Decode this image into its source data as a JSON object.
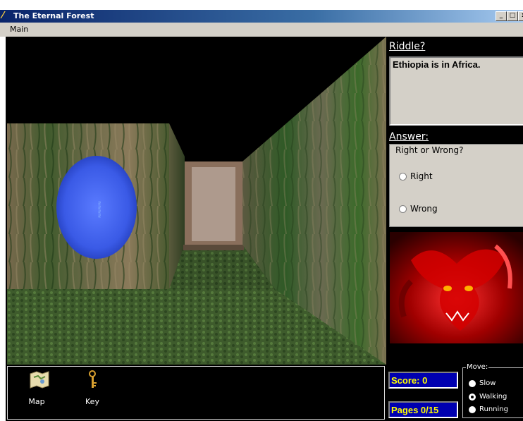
{
  "window": {
    "title": "The Eternal Forest",
    "minimize": "_",
    "maximize": "□",
    "close": "x"
  },
  "menu": {
    "items": [
      {
        "label": "Main"
      }
    ]
  },
  "riddle": {
    "header": "Riddle?",
    "text": "Ethiopia is in Africa."
  },
  "answer": {
    "header": "Answer:",
    "group_title": "Right or Wrong?",
    "options": [
      {
        "label": "Right",
        "selected": false
      },
      {
        "label": "Wrong",
        "selected": false
      }
    ]
  },
  "inventory": {
    "items": [
      {
        "label": "Map",
        "icon": "map-icon"
      },
      {
        "label": "Key",
        "icon": "key-icon"
      }
    ]
  },
  "status": {
    "score": "Score: 0",
    "pages": "Pages 0/15"
  },
  "move": {
    "title": "Move:",
    "options": [
      {
        "label": "Slow",
        "selected": false
      },
      {
        "label": "Walking",
        "selected": true
      },
      {
        "label": "Running",
        "selected": false
      }
    ]
  },
  "colors": {
    "titlebar": "#0a246a",
    "score_bg": "#0000b0",
    "score_text": "#ffff00",
    "portal": "#3d5ee8"
  }
}
